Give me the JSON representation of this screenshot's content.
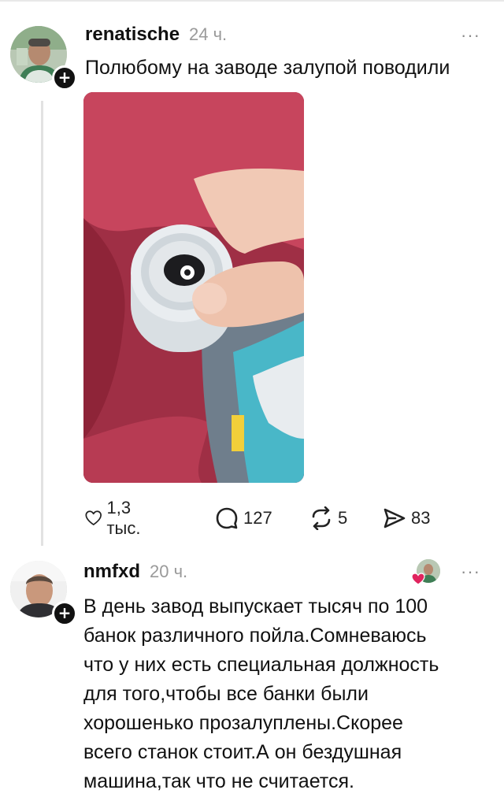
{
  "post": {
    "username": "renatische",
    "time": "24 ч.",
    "more": "···",
    "text": "Полюбому на заводе залупой поводили",
    "stats": {
      "likes": "1,3 тыс.",
      "comments": "127",
      "reposts": "5",
      "shares": "83"
    }
  },
  "reply": {
    "username": "nmfxd",
    "time": "20 ч.",
    "more": "···",
    "lines": [
      "В день завод выпускает тысяч по 100",
      "банок различного пойла.Сомневаюсь",
      "что у них есть специальная должность",
      "для того,чтобы все банки были",
      "хорошенько прозалуплены.Скорее",
      "всего станок стоит.А он бездушная",
      "машина,так что не считается."
    ]
  },
  "icons": {
    "follow": "plus-icon",
    "like": "heart-icon",
    "comment": "comment-bubble-icon",
    "repost": "repost-arrows-icon",
    "share": "send-arrow-icon",
    "liked_by_author": "red-heart-icon"
  },
  "colors": {
    "text": "#111111",
    "muted": "#9a9a9a",
    "heart": "#e0245e",
    "thread": "#e2e2e2"
  }
}
